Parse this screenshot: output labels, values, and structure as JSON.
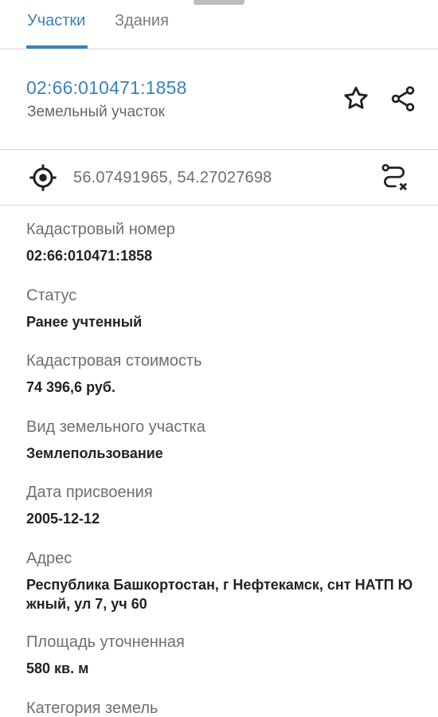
{
  "tabs": [
    {
      "label": "Участки"
    },
    {
      "label": "Здания"
    }
  ],
  "header": {
    "cadastral_number": "02:66:010471:1858",
    "object_type": "Земельный участок",
    "star_icon": "star-outline-icon",
    "share_icon": "share-icon"
  },
  "coordinates": {
    "text": "56.07491965, 54.27027698",
    "target_icon": "crosshair-target-icon",
    "route_icon": "route-clear-icon"
  },
  "fields": [
    {
      "label": "Кадастровый номер",
      "value": "02:66:010471:1858"
    },
    {
      "label": "Статус",
      "value": "Ранее учтенный"
    },
    {
      "label": "Кадастровая стоимость",
      "value": "74 396,6 руб."
    },
    {
      "label": "Вид земельного участка",
      "value": "Землепользование"
    },
    {
      "label": "Дата присвоения",
      "value": "2005-12-12"
    },
    {
      "label": "Адрес",
      "value_line1": "Республика Башкортостан, г Нефтекамск, снт НАТП Ю",
      "value_line2": "жный, ул 7, уч 60"
    },
    {
      "label": "Площадь уточненная",
      "value": "580 кв. м"
    },
    {
      "label": "Категория земель"
    }
  ],
  "colors": {
    "accent": "#3a82b7",
    "divider": "#d6d6d6",
    "label": "#6f6f6f",
    "value": "#222222"
  }
}
